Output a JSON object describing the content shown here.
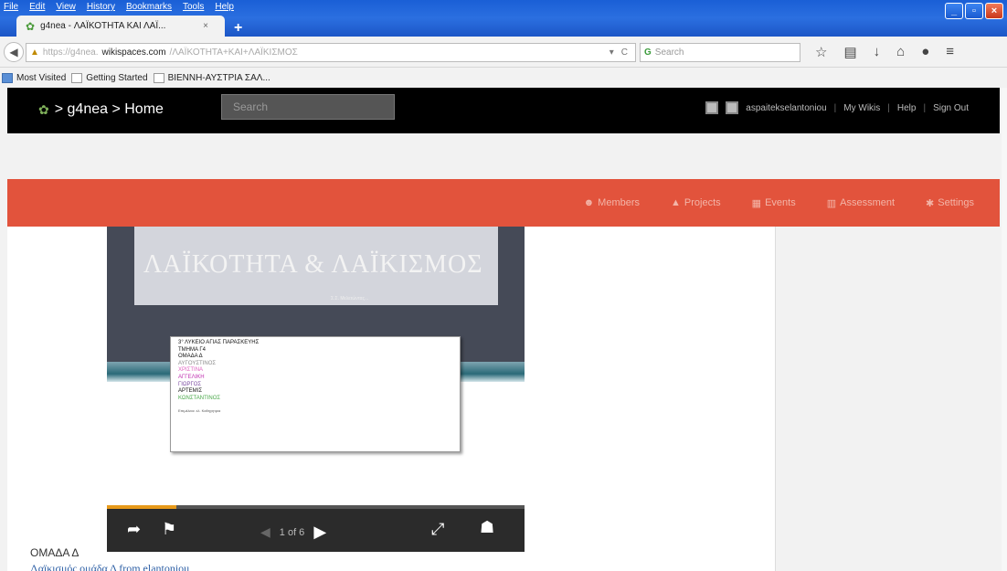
{
  "menu": [
    "File",
    "Edit",
    "View",
    "History",
    "Bookmarks",
    "Tools",
    "Help"
  ],
  "tab": {
    "title": "g4nea - ΛΑΪΚΟΤΗΤΑ ΚΑΙ ΛΑΪ...",
    "close": "×",
    "new_tab": "+"
  },
  "window": {
    "minimize": "_",
    "maximize": "▫",
    "close": "×"
  },
  "url": {
    "prefix": "https://g4nea.",
    "host": "wikispaces.com",
    "path": "/ΛΑΪΚΟΤΗΤΑ+ΚΑΙ+ΛΑΪΚΙΣΜΟΣ"
  },
  "search": {
    "placeholder": "Search"
  },
  "bookmarks": [
    "Most Visited",
    "Getting Started",
    "ΒΙΕΝΝΗ-ΑΥΣΤΡΙΑ ΣΑΛ..."
  ],
  "site": {
    "logo": "> g4nea > Home",
    "search_placeholder": "Search",
    "user": "aspaitekselantoniou",
    "links": [
      "My Wikis",
      "Help",
      "Sign Out"
    ]
  },
  "nav": [
    "Members",
    "Projects",
    "Events",
    "Assessment",
    "Settings"
  ],
  "slide": {
    "title": "ΛΑΪΚΟΤΗΤΑ & ΛΑΪΚΙΣΜΟΣ",
    "subtitle": "Σ.Σ. Μελετώντας...",
    "lines": [
      {
        "text": "3° ΛΥΚΕΙΟ ΑΓΙΑΣ ΠΑΡΑΣΚΕΥΗΣ",
        "color": "#111111"
      },
      {
        "text": "ΤΜΗΜΑ Γ4",
        "color": "#111111"
      },
      {
        "text": "ΟΜΑΔΑ Δ",
        "color": "#111111"
      },
      {
        "text": "ΑΥΓΟΥΣΤΙΝΟΣ",
        "color": "#8a8a8a"
      },
      {
        "text": "ΧΡΙΣΤΙΝΑ",
        "color": "#e060c0"
      },
      {
        "text": "ΑΓΓΕΛΙΚΗ",
        "color": "#c030b0"
      },
      {
        "text": "ΓΙΩΡΓΟΣ",
        "color": "#7a4aa0"
      },
      {
        "text": "ΑΡΤΕΜΙΣ",
        "color": "#111111"
      },
      {
        "text": "ΚΩΝΣΤΑΝΤΙΝΟΣ",
        "color": "#4aa84a"
      }
    ],
    "footer": "Επιμέλεια: ελ. Καθηγητρια"
  },
  "player": {
    "pager": "1 of 6",
    "progress": 0.167
  },
  "caption": "ΟΜΑΔΑ Δ",
  "link": "Λαϊκισμός ομάδα Δ from elantoniou",
  "colors": {
    "accent_nav": "#e2533c",
    "progress": "#e89a1a"
  }
}
